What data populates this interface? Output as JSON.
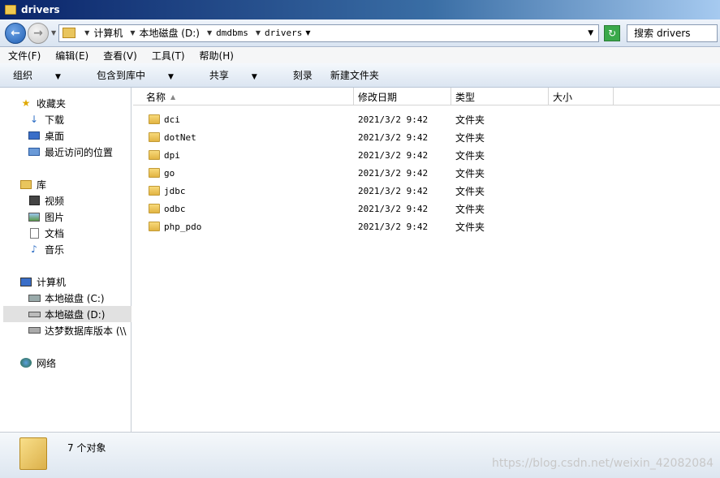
{
  "window": {
    "title": "drivers"
  },
  "address": {
    "crumbs": [
      "计算机",
      "本地磁盘 (D:)",
      "dmdbms",
      "drivers"
    ],
    "search_placeholder": "搜索 drivers"
  },
  "menu": [
    "文件(F)",
    "编辑(E)",
    "查看(V)",
    "工具(T)",
    "帮助(H)"
  ],
  "toolbar": {
    "organize": "组织",
    "include": "包含到库中",
    "share": "共享",
    "burn": "刻录",
    "new_folder": "新建文件夹"
  },
  "nav": {
    "favorites": "收藏夹",
    "downloads": "下载",
    "desktop": "桌面",
    "recent": "最近访问的位置",
    "libraries": "库",
    "videos": "视频",
    "pictures": "图片",
    "documents": "文档",
    "music": "音乐",
    "computer": "计算机",
    "drive_c": "本地磁盘 (C:)",
    "drive_d": "本地磁盘 (D:)",
    "network_drive": "达梦数据库版本 (\\\\",
    "network": "网络"
  },
  "columns": {
    "name": "名称",
    "date": "修改日期",
    "type": "类型",
    "size": "大小"
  },
  "files": [
    {
      "name": "dci",
      "date": "2021/3/2 9:42",
      "type": "文件夹"
    },
    {
      "name": "dotNet",
      "date": "2021/3/2 9:42",
      "type": "文件夹"
    },
    {
      "name": "dpi",
      "date": "2021/3/2 9:42",
      "type": "文件夹"
    },
    {
      "name": "go",
      "date": "2021/3/2 9:42",
      "type": "文件夹"
    },
    {
      "name": "jdbc",
      "date": "2021/3/2 9:42",
      "type": "文件夹"
    },
    {
      "name": "odbc",
      "date": "2021/3/2 9:42",
      "type": "文件夹"
    },
    {
      "name": "php_pdo",
      "date": "2021/3/2 9:42",
      "type": "文件夹"
    }
  ],
  "status": {
    "count": "7 个对象"
  },
  "watermark": "https://blog.csdn.net/weixin_42082084"
}
